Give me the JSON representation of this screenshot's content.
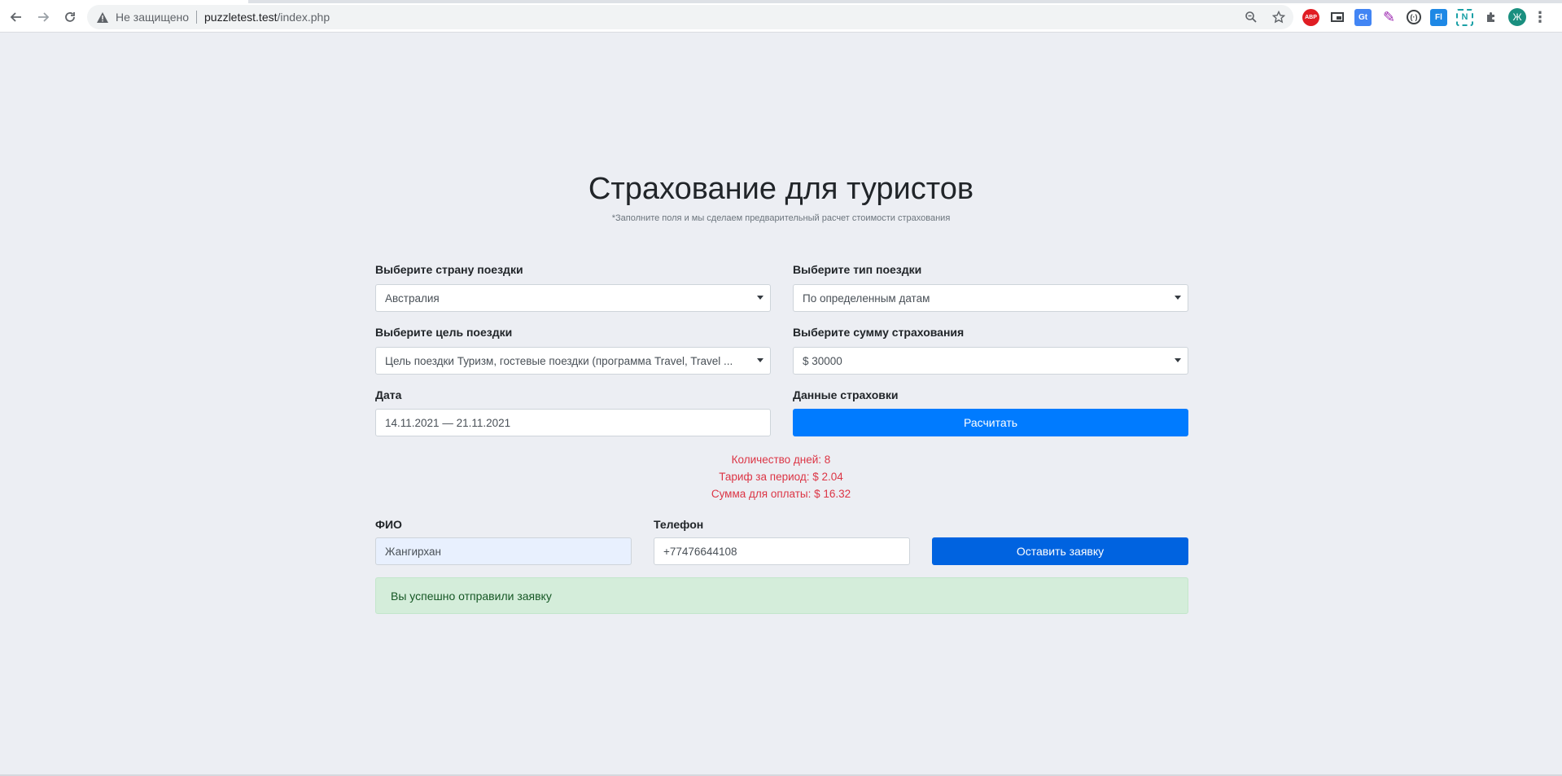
{
  "browser": {
    "insecure_label": "Не защищено",
    "url_host": "puzzletest.test",
    "url_path": "/index.php",
    "extensions": [
      "ABP",
      "Gt",
      "Fl",
      "N"
    ],
    "avatar_letter": "Ж"
  },
  "page": {
    "title": "Страхование для туристов",
    "subtitle": "*Заполните поля и мы сделаем предварительный расчет стоимости страхования"
  },
  "form": {
    "country": {
      "label": "Выберите страну поездки",
      "value": "Австралия"
    },
    "trip_type": {
      "label": "Выберите тип поездки",
      "value": "По определенным датам"
    },
    "purpose": {
      "label": "Выберите цель поездки",
      "value": "Цель поездки Туризм, гостевые поездки (программа Travel, Travel ..."
    },
    "sum": {
      "label": "Выберите сумму страхования",
      "value": "$ 30000"
    },
    "date": {
      "label": "Дата",
      "value": "14.11.2021 — 21.11.2021"
    },
    "insurance": {
      "label": "Данные страховки",
      "button": "Расчитать"
    }
  },
  "result": {
    "days": "Количество дней: 8",
    "tariff": "Тариф за период: $ 2.04",
    "total": "Сумма для оплаты: $ 16.32"
  },
  "contact": {
    "name": {
      "label": "ФИО",
      "value": "Жангирхан"
    },
    "phone": {
      "label": "Телефон",
      "value": "+77476644108"
    },
    "submit": "Оставить заявку"
  },
  "alert": {
    "text": "Вы успешно отправили заявку"
  },
  "colors": {
    "background": "#eceef3",
    "primary": "#007bff",
    "result_text": "#dc3545",
    "alert_bg": "#d4edda",
    "alert_text": "#155724"
  }
}
